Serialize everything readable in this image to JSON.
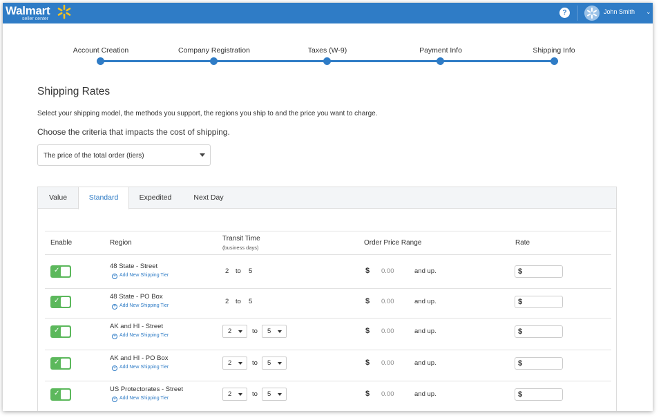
{
  "header": {
    "brand": "Walmart",
    "brand_sub": "seller center",
    "help_label": "?",
    "user_name": "John Smith",
    "accent": "#2f7cc6"
  },
  "stepper": {
    "steps": [
      "Account Creation",
      "Company Registration",
      "Taxes (W-9)",
      "Payment Info",
      "Shipping Info"
    ]
  },
  "page": {
    "title": "Shipping Rates",
    "description": "Select your shipping model, the methods you support, the regions you ship to and the price you want to charge.",
    "criteria_label": "Choose the criteria that impacts the cost of shipping.",
    "criteria_value": "The price of the total order (tiers)"
  },
  "tabs": [
    "Value",
    "Standard",
    "Expedited",
    "Next Day"
  ],
  "active_tab": "Standard",
  "table": {
    "headers": {
      "enable": "Enable",
      "region": "Region",
      "transit": "Transit Time",
      "transit_sub": "(business days)",
      "price_range": "Order Price Range",
      "rate": "Rate"
    },
    "add_tier_label": "Add New Shipping Tier",
    "to_label": "to",
    "currency": "$",
    "and_up_label": "and up.",
    "rows": [
      {
        "region": "48 State - Street",
        "transit_min": "2",
        "transit_max": "5",
        "editable": false,
        "price": "0.00"
      },
      {
        "region": "48 State - PO Box",
        "transit_min": "2",
        "transit_max": "5",
        "editable": false,
        "price": "0.00"
      },
      {
        "region": "AK and HI - Street",
        "transit_min": "2",
        "transit_max": "5",
        "editable": true,
        "price": "0.00"
      },
      {
        "region": "AK and HI - PO Box",
        "transit_min": "2",
        "transit_max": "5",
        "editable": true,
        "price": "0.00"
      },
      {
        "region": "US Protectorates - Street",
        "transit_min": "2",
        "transit_max": "5",
        "editable": true,
        "price": "0.00"
      }
    ]
  }
}
